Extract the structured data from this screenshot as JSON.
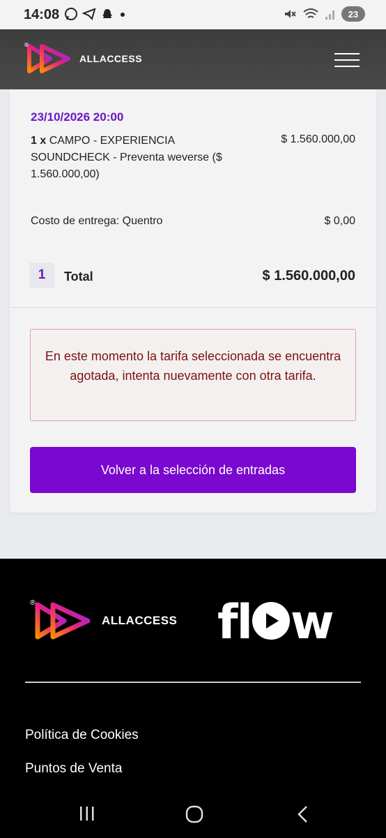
{
  "status_bar": {
    "time": "14:08",
    "battery": "23"
  },
  "header": {
    "brand": "ALLACCESS"
  },
  "order": {
    "event_date": "23/10/2026 20:00",
    "item_qty": "1 x",
    "item_description": "CAMPO - EXPERIENCIA SOUNDCHECK - Preventa weverse ($ 1.560.000,00)",
    "item_price": "$ 1.560.000,00",
    "delivery_label": "Costo de entrega: Quentro",
    "delivery_price": "$ 0,00",
    "quantity": "1",
    "total_label": "Total",
    "total_value": "$ 1.560.000,00"
  },
  "alert": {
    "message": "En este momento la tarifa seleccionada se encuentra agotada, intenta nuevamente con otra tarifa."
  },
  "actions": {
    "back_label": "Volver a la selección de entradas"
  },
  "footer": {
    "brand": "ALLACCESS",
    "partner_logo_text_1": "fl",
    "partner_logo_text_2": "w",
    "links": [
      "Política de Cookies",
      "Puntos de Venta"
    ]
  },
  "colors": {
    "accent": "#7a08cf",
    "date": "#6b16c4",
    "alert_border": "#e69c9c",
    "alert_text": "#7a1212"
  }
}
